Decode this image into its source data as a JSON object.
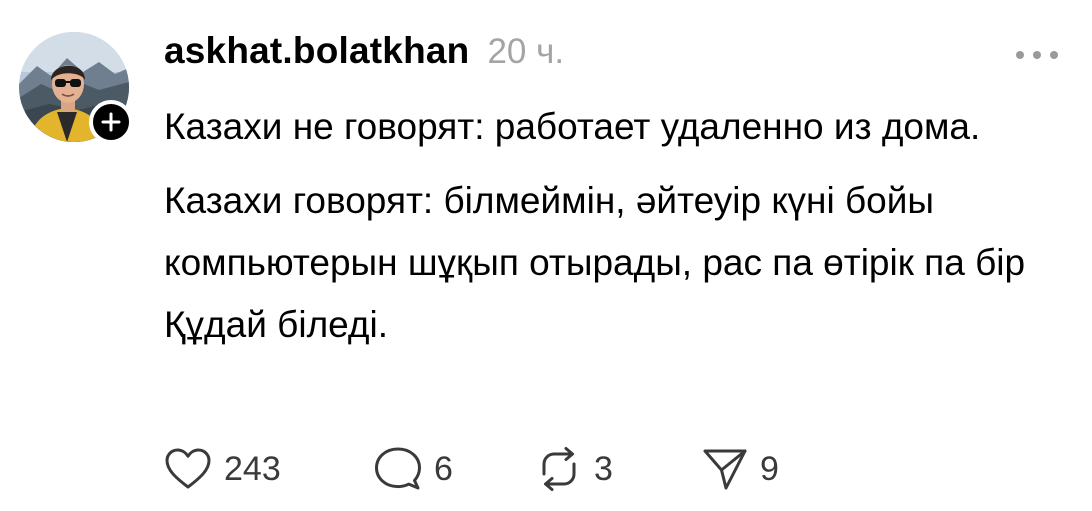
{
  "post": {
    "username": "askhat.bolatkhan",
    "timestamp": "20 ч.",
    "body_paragraphs": [
      "Казахи не говорят: работает удаленно из дома.",
      "Казахи говорят: білмеймін, әйтеуір күні бойы компьютерын шұқып отырады, рас па өтірік па бір Құдай біледі."
    ],
    "actions": {
      "likes": "243",
      "replies": "6",
      "reposts": "3",
      "shares": "9"
    }
  },
  "icons": {
    "avatar": "user-avatar-photo",
    "follow": "plus-icon",
    "more": "more-dots-icon",
    "like": "heart-icon",
    "reply": "comment-bubble-icon",
    "repost": "repost-arrows-icon",
    "share": "send-icon"
  },
  "colors": {
    "text": "#000000",
    "muted": "#a4a4a4",
    "icon": "#3a3a3a",
    "background": "#ffffff"
  }
}
